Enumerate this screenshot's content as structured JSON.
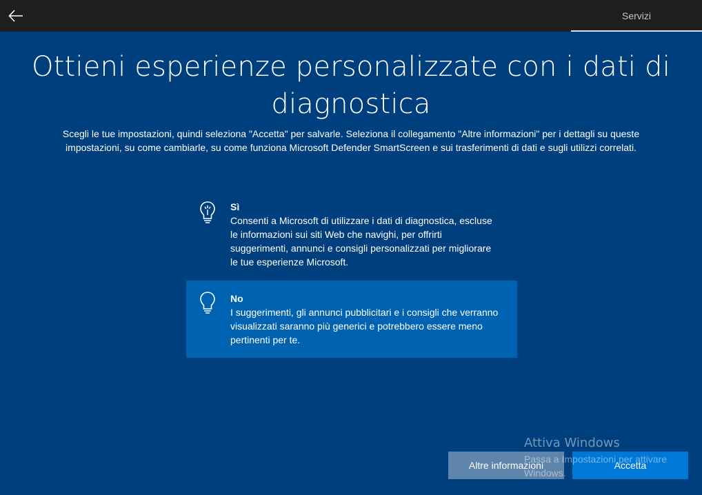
{
  "header": {
    "back_icon": "back-arrow-icon",
    "section": "Servizi"
  },
  "page": {
    "title_line1": "Ottieni esperienze personalizzate con i dati di",
    "title_line2": "diagnostica",
    "subtitle_line1": "Scegli le tue impostazioni, quindi seleziona \"Accetta\" per salvarle. Seleziona il collegamento \"Altre informazioni\" per i dettagli su queste",
    "subtitle_line2": "impostazioni, su come cambiarle, su come funziona Microsoft Defender SmartScreen e sui trasferimenti di dati e sugli utilizzi correlati."
  },
  "options": [
    {
      "icon": "lightbulb-on-icon",
      "title": "Sì",
      "description": "Consenti a Microsoft di utilizzare i dati di diagnostica, escluse le informazioni sui siti Web che navighi, per offrirti suggerimenti, annunci e consigli personalizzati per migliorare le tue esperienze Microsoft.",
      "selected": false
    },
    {
      "icon": "lightbulb-off-icon",
      "title": "No",
      "description": "I suggerimenti, gli annunci pubblicitari e i consigli che verranno visualizzati saranno più generici e potrebbero essere meno pertinenti per te.",
      "selected": true
    }
  ],
  "watermark": {
    "title": "Attiva Windows",
    "subtitle": "Passa a Impostazioni per attivare Windows."
  },
  "buttons": {
    "more_info": "Altre informazioni",
    "accept": "Accetta"
  },
  "colors": {
    "background": "#003f7d",
    "topbar": "#1e1e1e",
    "selected_option": "#0063b1",
    "accent": "#0078d7"
  }
}
